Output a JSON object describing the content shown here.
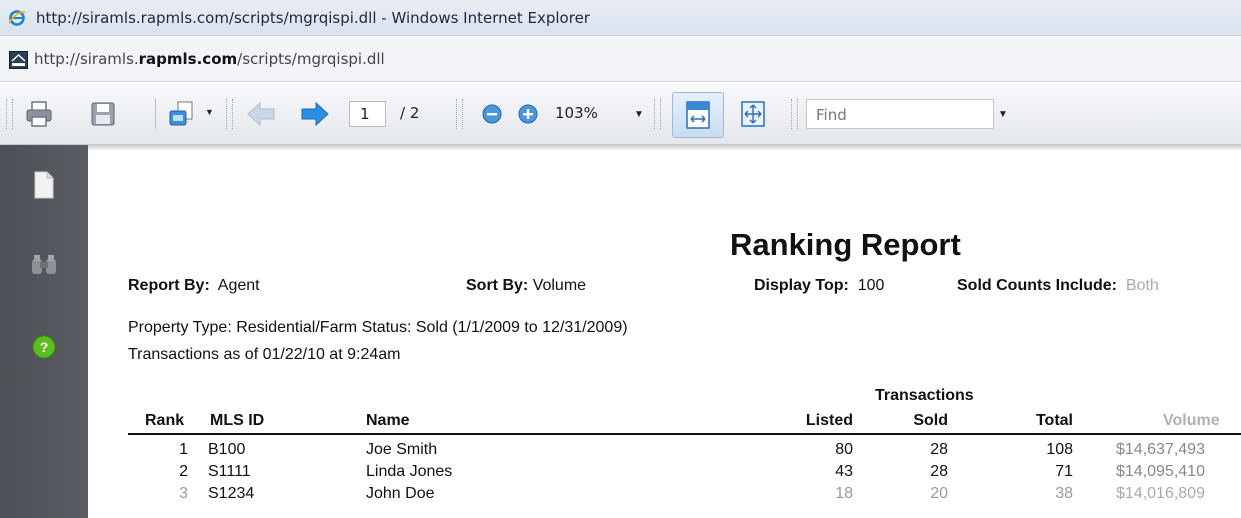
{
  "window": {
    "title": "http://siramls.rapmls.com/scripts/mgrqispi.dll - Windows Internet Explorer"
  },
  "address": {
    "prefix": "http://siramls.",
    "domain": "rapmls.com",
    "path": "/scripts/mgrqispi.dll"
  },
  "toolbar": {
    "page_current": "1",
    "page_total": "/ 2",
    "zoom": "103%",
    "find_placeholder": "Find",
    "icons": [
      "print-icon",
      "save-icon",
      "properties-icon",
      "prev-page-icon",
      "next-page-icon",
      "zoom-out-icon",
      "zoom-in-icon",
      "fit-width-icon",
      "fit-page-icon"
    ]
  },
  "leftnav": {
    "icons": [
      "pages-icon",
      "binoculars-icon",
      "help-icon"
    ]
  },
  "report": {
    "title": "Ranking Report",
    "report_by_label": "Report By:",
    "report_by_value": "Agent",
    "sort_by_label": "Sort By:",
    "sort_by_value": "Volume",
    "display_top_label": "Display Top:",
    "display_top_value": "100",
    "sold_counts_label": "Sold Counts Include:",
    "sold_counts_value": "Both",
    "property_line": "Property Type:  Residential/Farm Status:  Sold (1/1/2009 to 12/31/2009)",
    "transactions_line": "Transactions as of 01/22/10 at 9:24am",
    "group_header": "Transactions",
    "columns": {
      "rank": "Rank",
      "mls_id": "MLS ID",
      "name": "Name",
      "listed": "Listed",
      "sold": "Sold",
      "total": "Total",
      "volume": "Volume"
    },
    "rows": [
      {
        "rank": "1",
        "mls_id": "B100",
        "name": "Joe Smith",
        "listed": "80",
        "sold": "28",
        "total": "108",
        "volume": "$14,637,493"
      },
      {
        "rank": "2",
        "mls_id": "S1111",
        "name": "Linda Jones",
        "listed": "43",
        "sold": "28",
        "total": "71",
        "volume": "$14,095,410"
      },
      {
        "rank": "3",
        "mls_id": "S1234",
        "name": "John Doe",
        "listed": "18",
        "sold": "20",
        "total": "38",
        "volume": "$14,016,809"
      }
    ]
  },
  "colors": {
    "nav_bg": "#4c4f54",
    "help_green": "#5bbd1e",
    "arrow_blue": "#2b8ee0"
  }
}
